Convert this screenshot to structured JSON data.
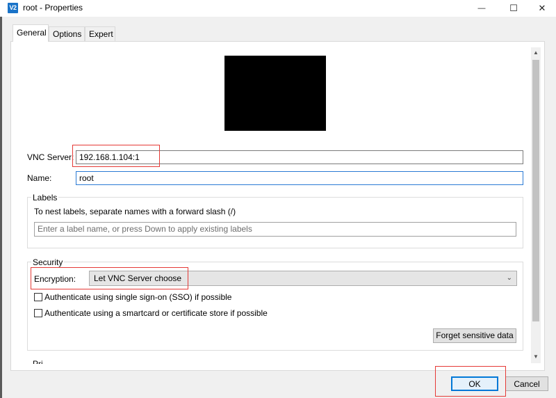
{
  "window": {
    "title": "root - Properties",
    "app_icon_text": "V2",
    "minimize_glyph": "—",
    "maximize_glyph": "☐",
    "close_glyph": "✕"
  },
  "tabs": [
    {
      "label": "General",
      "active": true
    },
    {
      "label": "Options",
      "active": false
    },
    {
      "label": "Expert",
      "active": false
    }
  ],
  "general": {
    "vnc_server_label": "VNC Server:",
    "vnc_server_value": "192.168.1.104:1",
    "name_label": "Name:",
    "name_value": "root"
  },
  "labels_group": {
    "title": "Labels",
    "hint": "To nest labels, separate names with a forward slash (/)",
    "input_placeholder": "Enter a label name, or press Down to apply existing labels"
  },
  "security_group": {
    "title": "Security",
    "encryption_label": "Encryption:",
    "encryption_value": "Let VNC Server choose",
    "sso_label": "Authenticate using single sign-on (SSO) if possible",
    "smartcard_label": "Authenticate using a smartcard or certificate store if possible",
    "forget_button": "Forget sensitive data"
  },
  "next_group_partial": "Pri",
  "buttons": {
    "ok": "OK",
    "cancel": "Cancel"
  },
  "scrollbar": {
    "up_glyph": "▲",
    "down_glyph": "▼"
  },
  "colors": {
    "accent": "#0078d7",
    "annotation_red": "#e53935",
    "focus_border": "#2a7ad4"
  }
}
